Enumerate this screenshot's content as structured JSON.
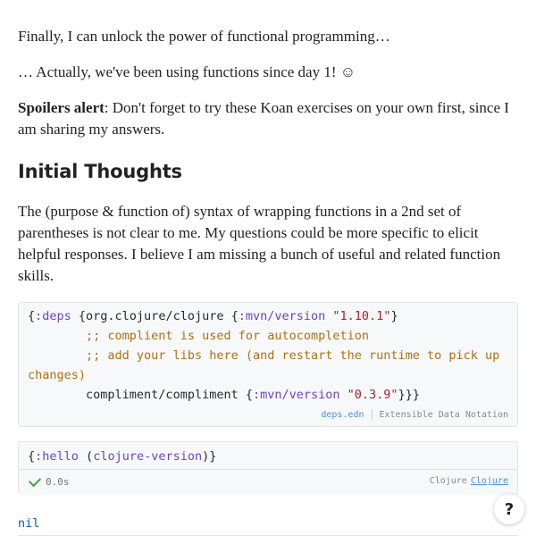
{
  "paragraphs": {
    "p1": "Finally, I can unlock the power of functional programming…",
    "p2": "… Actually, we've been using functions since day 1! ☺",
    "p3_bold": "Spoilers alert",
    "p3_rest": ": Don't forget to try these Koan exercises on your own first, since I am sharing my answers.",
    "p4": "The (purpose & function of) syntax of wrapping functions in a 2nd set of parentheses is not clear to me. My questions could be more specific to elicit helpful responses. I believe I am missing a bunch of useful and related function skills."
  },
  "heading": "Initial Thoughts",
  "code_block_1": {
    "lines": {
      "l1_open": "{",
      "l1_key": ":deps",
      "l1_map_open": " {org.clojure/clojure {",
      "l1_key2": ":mvn/version",
      "l1_sp": " ",
      "l1_str": "\"1.10.1\"",
      "l1_close": "}",
      "l2_indent": "        ",
      "l2_comment": ";; complient is used for autocompletion",
      "l3_comment": ";; add your libs here (and restart the runtime to pick up changes)",
      "l4_sym": "compliment/compliment {",
      "l4_key": ":mvn/version",
      "l4_str": "\"0.3.9\"",
      "l4_close": "}}}"
    },
    "filename": "deps.edn",
    "format": "Extensible Data Notation"
  },
  "code_block_2": {
    "open": "{",
    "key": ":hello",
    "paren_open": " (",
    "fn": "clojure-version",
    "close": ")}",
    "time": "0.0s",
    "lang_label": "Clojure",
    "lang_link": "Clojure"
  },
  "result": "nil",
  "help_button": "?",
  "colors": {
    "keyword": "#6f42c1",
    "key2": "#005cc5",
    "string": "#b31d28",
    "comment": "#b0700f",
    "check": "#3fa63f"
  }
}
